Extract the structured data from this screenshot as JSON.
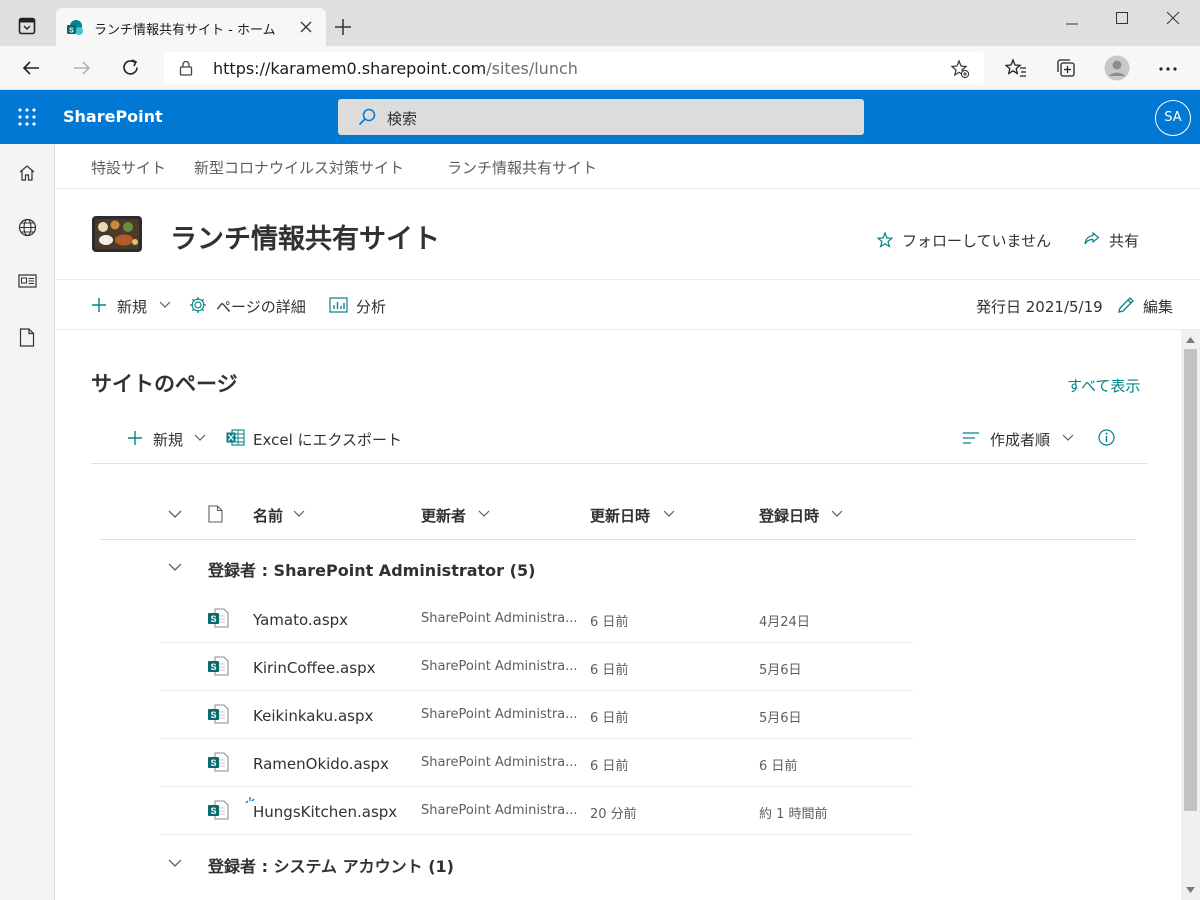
{
  "browser": {
    "tab_title": "ランチ情報共有サイト - ホーム",
    "url_host": "https://karamem0.sharepoint.com",
    "url_path": "/sites/lunch"
  },
  "suite": {
    "brand": "SharePoint",
    "search_placeholder": "検索",
    "avatar_initials": "SA"
  },
  "hub_nav": [
    "特設サイト",
    "新型コロナウイルス対策サイト",
    "ランチ情報共有サイト"
  ],
  "site": {
    "title": "ランチ情報共有サイト",
    "follow_label": "フォローしていません",
    "share_label": "共有"
  },
  "command_bar": {
    "new_label": "新規",
    "page_details_label": "ページの詳細",
    "analytics_label": "分析",
    "published_label": "発行日 2021/5/19",
    "edit_label": "編集"
  },
  "web_part": {
    "title": "サイトのページ",
    "see_all": "すべて表示",
    "new_label": "新規",
    "export_label": "Excel にエクスポート",
    "sort_label": "作成者順",
    "columns": {
      "name": "名前",
      "modified_by": "更新者",
      "modified": "更新日時",
      "created": "登録日時"
    },
    "groups": [
      {
        "header": "登録者 : SharePoint Administrator (5)",
        "rows": [
          {
            "name": "Yamato.aspx",
            "modified_by": "SharePoint Administra...",
            "modified": "6 日前",
            "created": "4月24日"
          },
          {
            "name": "KirinCoffee.aspx",
            "modified_by": "SharePoint Administra...",
            "modified": "6 日前",
            "created": "5月6日"
          },
          {
            "name": "Keikinkaku.aspx",
            "modified_by": "SharePoint Administra...",
            "modified": "6 日前",
            "created": "5月6日"
          },
          {
            "name": "RamenOkido.aspx",
            "modified_by": "SharePoint Administra...",
            "modified": "6 日前",
            "created": "6 日前"
          },
          {
            "name": "HungsKitchen.aspx",
            "modified_by": "SharePoint Administra...",
            "modified": "20 分前",
            "created": "約 1 時間前"
          }
        ]
      },
      {
        "header": "登録者 : システム アカウント (1)",
        "rows": []
      }
    ]
  },
  "colors": {
    "suite_bar": "#0078d4",
    "accent_teal": "#038387",
    "sharepoint_icon": "#036c70"
  },
  "icons": [
    "browser-window-icon",
    "sharepoint-favicon",
    "close-icon",
    "new-tab-icon",
    "back-icon",
    "forward-icon",
    "refresh-icon",
    "lock-icon",
    "favorite-add-icon",
    "favorites-icon",
    "collections-icon",
    "profile-icon",
    "more-icon",
    "minimize-icon",
    "maximize-icon",
    "app-launcher-icon",
    "search-icon",
    "home-icon",
    "globe-icon",
    "news-icon",
    "document-icon",
    "star-icon",
    "share-icon",
    "plus-icon",
    "chevron-down-icon",
    "gear-icon",
    "analytics-icon",
    "edit-icon",
    "excel-icon",
    "sort-lines-icon",
    "info-icon",
    "file-type-icon",
    "sharepoint-page-icon"
  ]
}
